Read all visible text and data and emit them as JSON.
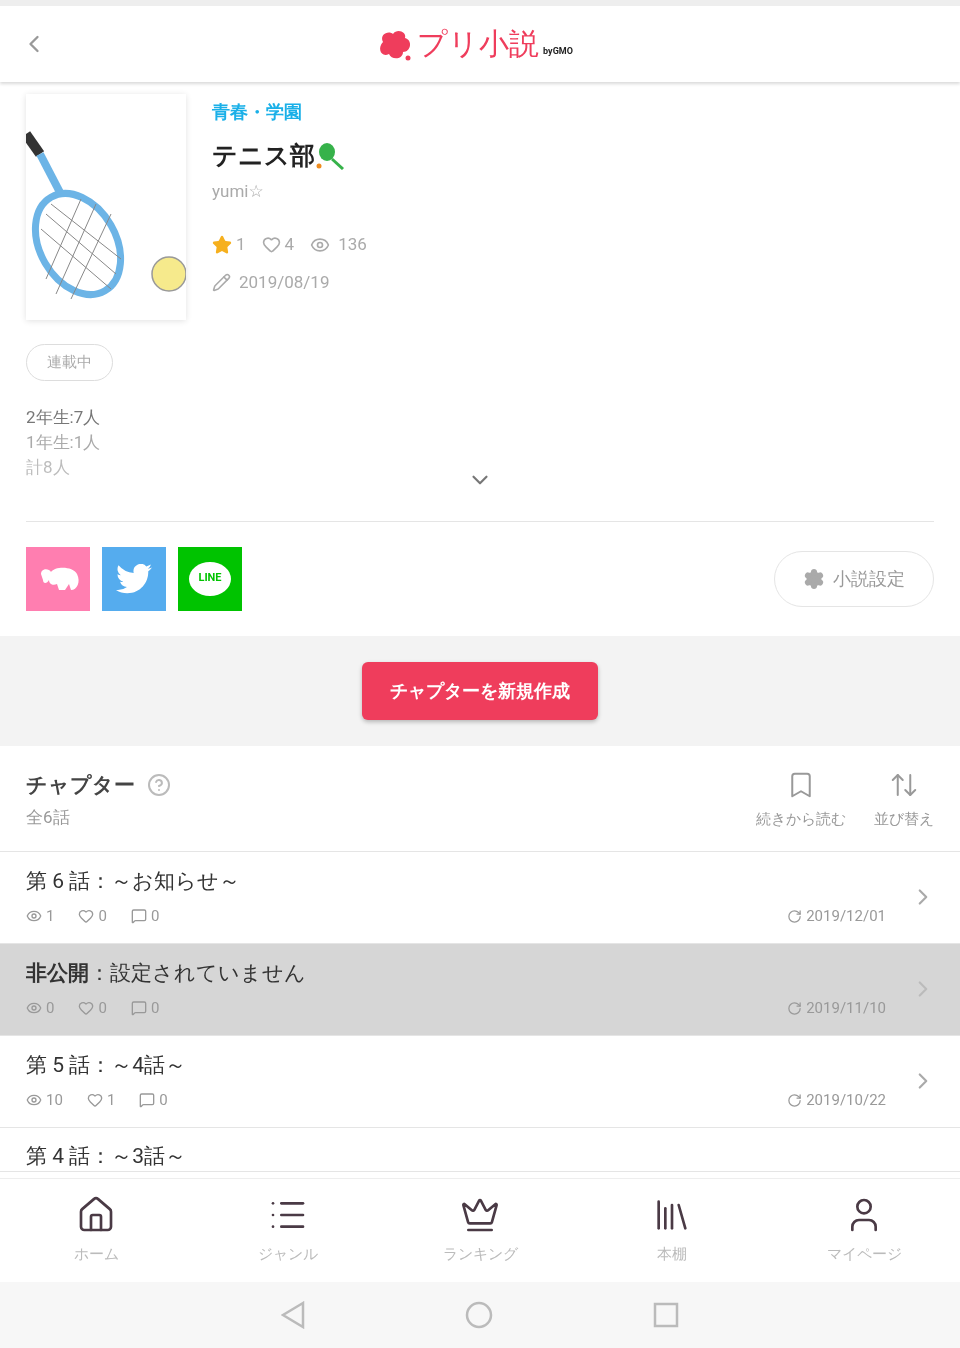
{
  "header": {
    "logo_text": "プリ小説",
    "logo_suffix": "byGMO"
  },
  "novel": {
    "genre": "青春・学園",
    "title": "テニス部",
    "author": "yumi☆",
    "stars": "1",
    "likes": "4",
    "views": "136",
    "date": "2019/08/19",
    "status": "連載中",
    "description": [
      "2年生:7人",
      "1年生:1人",
      "計8人"
    ],
    "expanded": false
  },
  "share": [
    {
      "kind": "elephant"
    },
    {
      "kind": "twitter"
    },
    {
      "kind": "line",
      "label": "LINE"
    }
  ],
  "settings_button": "小説設定",
  "create_button": "チャプターを新規作成",
  "chapters_header": {
    "title": "チャプター",
    "count": "全6話",
    "actions": [
      {
        "kind": "bookmark",
        "label": "続きから読む"
      },
      {
        "kind": "sort",
        "label": "並び替え"
      }
    ]
  },
  "chapters": [
    {
      "kind": "published",
      "title": "第 6 話：～お知らせ～",
      "views": "1",
      "likes": "0",
      "comments": "0",
      "date": "2019/12/01"
    },
    {
      "kind": "private",
      "title": "**非公開**：設定されていません",
      "views": "0",
      "likes": "0",
      "comments": "0",
      "date": "2019/11/10"
    },
    {
      "kind": "published",
      "title": "第 5 話：～4話～",
      "views": "10",
      "likes": "1",
      "comments": "0",
      "date": "2019/10/22"
    },
    {
      "kind": "published",
      "title": "第 4 話：～3話～"
    }
  ],
  "bottom_nav": [
    {
      "kind": "home",
      "label": "ホーム"
    },
    {
      "kind": "genre",
      "label": "ジャンル"
    },
    {
      "kind": "ranking",
      "label": "ランキング"
    },
    {
      "kind": "shelf",
      "label": "本棚"
    },
    {
      "kind": "mypage",
      "label": "マイページ"
    }
  ]
}
